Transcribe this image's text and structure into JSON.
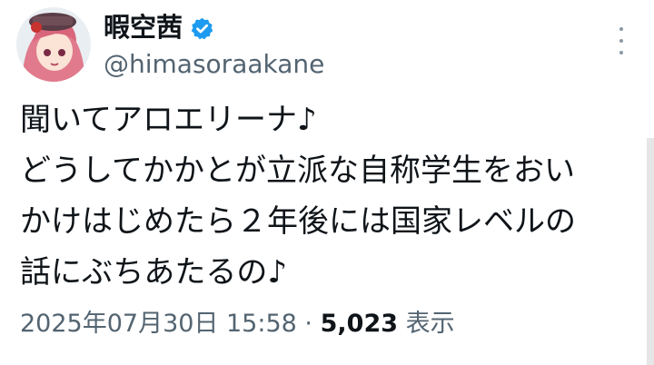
{
  "author": {
    "display_name": "暇空茜",
    "handle": "@himasoraakane",
    "verified": true,
    "avatar_icon": "anime-girl-avatar-icon"
  },
  "tweet": {
    "lines": [
      "聞いてアロエリーナ♪",
      "どうしてかかとが立派な自称学生をおい",
      "かけはじめたら２年後には国家レベルの",
      "話にぶちあたるの♪"
    ]
  },
  "meta": {
    "timestamp": "2025年07月30日 15:58",
    "separator": "·",
    "views_count": "5,023",
    "views_label": "表示"
  },
  "colors": {
    "verified": "#1d9bf0",
    "secondary_text": "#536471",
    "primary_text": "#0f1419"
  }
}
